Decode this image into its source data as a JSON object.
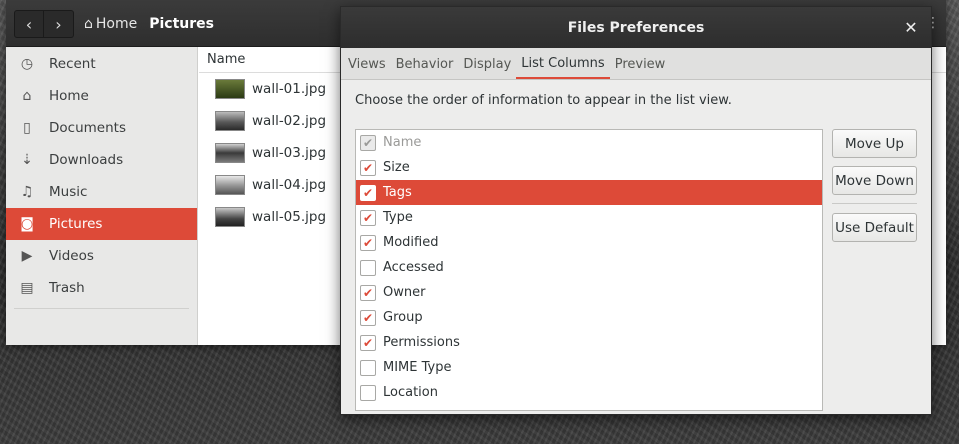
{
  "files": {
    "path": {
      "home": "Home",
      "current": "Pictures"
    },
    "sidebar": [
      {
        "label": "Recent",
        "icon": "clock-icon",
        "glyph": "◷"
      },
      {
        "label": "Home",
        "icon": "home-icon",
        "glyph": "⌂"
      },
      {
        "label": "Documents",
        "icon": "document-icon",
        "glyph": "▯"
      },
      {
        "label": "Downloads",
        "icon": "download-icon",
        "glyph": "⇣"
      },
      {
        "label": "Music",
        "icon": "music-icon",
        "glyph": "♫"
      },
      {
        "label": "Pictures",
        "icon": "camera-icon",
        "glyph": "◙"
      },
      {
        "label": "Videos",
        "icon": "video-icon",
        "glyph": "▶"
      },
      {
        "label": "Trash",
        "icon": "trash-icon",
        "glyph": "▤"
      }
    ],
    "column_header": "Name",
    "files": [
      "wall-01.jpg",
      "wall-02.jpg",
      "wall-03.jpg",
      "wall-04.jpg",
      "wall-05.jpg"
    ]
  },
  "prefs": {
    "title": "Files Preferences",
    "tabs": [
      "Views",
      "Behavior",
      "Display",
      "List Columns",
      "Preview"
    ],
    "description": "Choose the order of information to appear in the list view.",
    "columns": [
      {
        "label": "Name",
        "checked": true,
        "disabled": true
      },
      {
        "label": "Size",
        "checked": true
      },
      {
        "label": "Tags",
        "checked": true,
        "selected": true
      },
      {
        "label": "Type",
        "checked": true
      },
      {
        "label": "Modified",
        "checked": true
      },
      {
        "label": "Accessed",
        "checked": false
      },
      {
        "label": "Owner",
        "checked": true
      },
      {
        "label": "Group",
        "checked": true
      },
      {
        "label": "Permissions",
        "checked": true
      },
      {
        "label": "MIME Type",
        "checked": false
      },
      {
        "label": "Location",
        "checked": false
      }
    ],
    "buttons": {
      "move_up": "Move Up",
      "move_down": "Move Down",
      "use_default": "Use Default"
    }
  },
  "colors": {
    "accent": "#dd4a38",
    "headerbar": "#2e2e2e"
  }
}
